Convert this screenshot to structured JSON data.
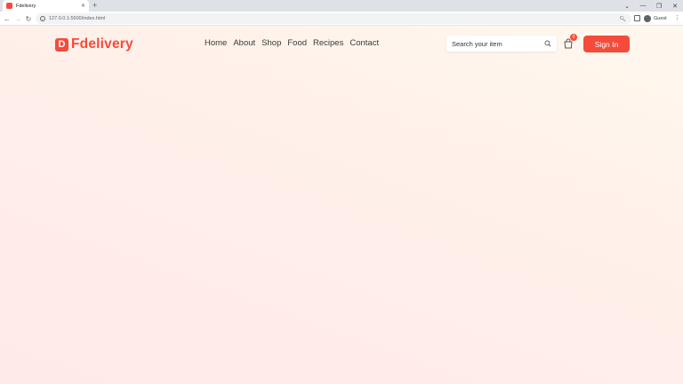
{
  "browser": {
    "tab_title": "Fdelivery",
    "tab_close": "✕",
    "new_tab": "+",
    "url": "127.0.0.1:5500/index.html",
    "profile_name": "Guest",
    "window_controls": [
      "⌄",
      "—",
      "❐",
      "✕"
    ]
  },
  "site": {
    "logo_mark": "D",
    "logo_text": "Fdelivery",
    "brand_color": "#f54b3a"
  },
  "nav": {
    "items": [
      "Home",
      "About",
      "Shop",
      "Food",
      "Recipes",
      "Contact"
    ]
  },
  "search": {
    "placeholder": "Search your item"
  },
  "cart": {
    "count": "0"
  },
  "signin": {
    "label": "Sign In"
  }
}
